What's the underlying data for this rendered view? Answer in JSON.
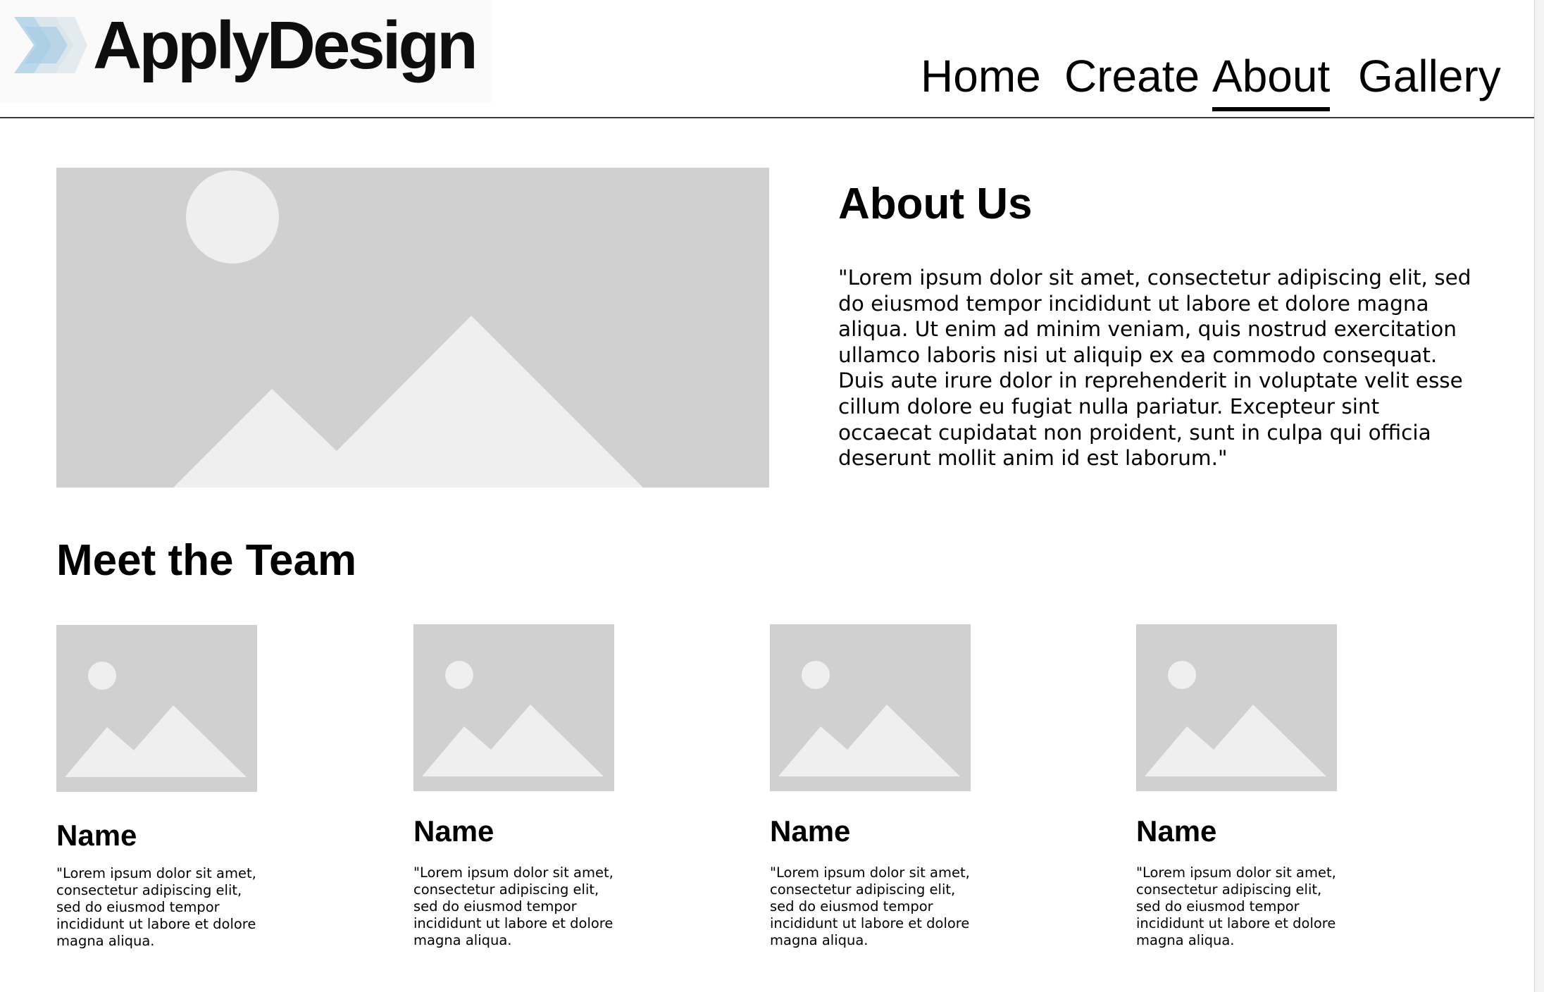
{
  "header": {
    "logo_text": "ApplyDesign",
    "nav": [
      {
        "label": "Home",
        "active": false
      },
      {
        "label": "Create",
        "active": false
      },
      {
        "label": "About",
        "active": true
      },
      {
        "label": "Gallery",
        "active": false
      }
    ]
  },
  "about": {
    "title": "About Us",
    "body": "\"Lorem ipsum dolor sit amet, consectetur adipiscing elit, sed do eiusmod tempor incididunt ut labore et dolore magna aliqua. Ut enim ad minim veniam, quis nostrud exercitation ullamco laboris nisi ut aliquip ex ea commodo consequat. Duis aute irure dolor in reprehenderit in voluptate velit esse cillum dolore eu fugiat nulla pariatur. Excepteur sint occaecat cupidatat non proident, sunt in culpa qui officia deserunt mollit anim id est laborum.\""
  },
  "team": {
    "title": "Meet the Team",
    "members": [
      {
        "name": "Name",
        "bio": "\"Lorem ipsum dolor sit amet, consectetur adipiscing elit, sed do eiusmod tempor incididunt ut labore et dolore magna aliqua."
      },
      {
        "name": "Name",
        "bio": "\"Lorem ipsum dolor sit amet, consectetur adipiscing elit, sed do eiusmod tempor incididunt ut labore et dolore magna aliqua."
      },
      {
        "name": "Name",
        "bio": "\"Lorem ipsum dolor sit amet, consectetur adipiscing elit, sed do eiusmod tempor incididunt ut labore et dolore magna aliqua."
      },
      {
        "name": "Name",
        "bio": "\"Lorem ipsum dolor sit amet, consectetur adipiscing elit, sed do eiusmod tempor incididunt ut labore et dolore magna aliqua."
      }
    ]
  },
  "colors": {
    "placeholder_bg": "#d0d0d0",
    "placeholder_fg": "#efefef",
    "logo_mark": "#a9cde4",
    "text": "#000000"
  },
  "icons": {
    "logo_mark": "chevron-logo-icon",
    "placeholder": "image-placeholder-icon"
  }
}
